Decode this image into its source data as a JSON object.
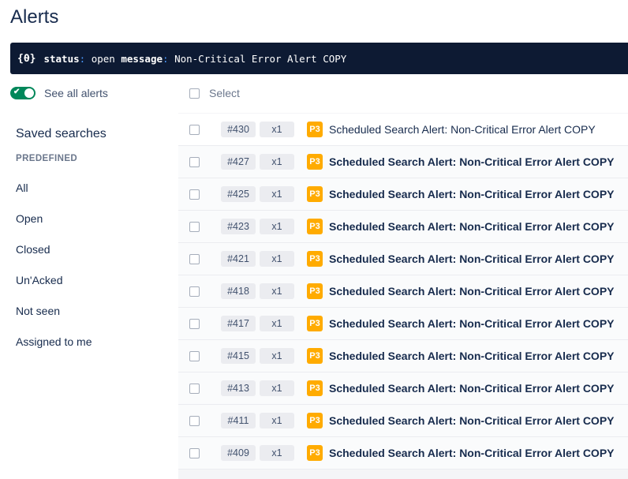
{
  "page": {
    "title": "Alerts"
  },
  "search": {
    "icon": "query-icon",
    "icon_glyph": "{⍬}",
    "query_tokens": [
      {
        "kind": "key",
        "text": "status"
      },
      {
        "kind": "colon",
        "text": ":"
      },
      {
        "kind": "val",
        "text": " open "
      },
      {
        "kind": "key",
        "text": "message"
      },
      {
        "kind": "colon",
        "text": ":"
      },
      {
        "kind": "val",
        "text": " Non-Critical Error Alert COPY"
      }
    ]
  },
  "toggle": {
    "label": "See all alerts",
    "checked": true,
    "color": "#00875a"
  },
  "select": {
    "label": "Select"
  },
  "sidebar": {
    "heading": "Saved searches",
    "section": "PREDEFINED",
    "items": [
      {
        "label": "All"
      },
      {
        "label": "Open"
      },
      {
        "label": "Closed"
      },
      {
        "label": "Un'Acked"
      },
      {
        "label": "Not seen"
      },
      {
        "label": "Assigned to me"
      }
    ]
  },
  "alerts": [
    {
      "id": "#430",
      "count": "x1",
      "priority": "P3",
      "title": "Scheduled Search Alert: Non-Critical Error Alert COPY",
      "unread": false
    },
    {
      "id": "#427",
      "count": "x1",
      "priority": "P3",
      "title": "Scheduled Search Alert: Non-Critical Error Alert COPY",
      "unread": true
    },
    {
      "id": "#425",
      "count": "x1",
      "priority": "P3",
      "title": "Scheduled Search Alert: Non-Critical Error Alert COPY",
      "unread": true
    },
    {
      "id": "#423",
      "count": "x1",
      "priority": "P3",
      "title": "Scheduled Search Alert: Non-Critical Error Alert COPY",
      "unread": true
    },
    {
      "id": "#421",
      "count": "x1",
      "priority": "P3",
      "title": "Scheduled Search Alert: Non-Critical Error Alert COPY",
      "unread": true
    },
    {
      "id": "#418",
      "count": "x1",
      "priority": "P3",
      "title": "Scheduled Search Alert: Non-Critical Error Alert COPY",
      "unread": true
    },
    {
      "id": "#417",
      "count": "x1",
      "priority": "P3",
      "title": "Scheduled Search Alert: Non-Critical Error Alert COPY",
      "unread": true
    },
    {
      "id": "#415",
      "count": "x1",
      "priority": "P3",
      "title": "Scheduled Search Alert: Non-Critical Error Alert COPY",
      "unread": true
    },
    {
      "id": "#413",
      "count": "x1",
      "priority": "P3",
      "title": "Scheduled Search Alert: Non-Critical Error Alert COPY",
      "unread": true
    },
    {
      "id": "#411",
      "count": "x1",
      "priority": "P3",
      "title": "Scheduled Search Alert: Non-Critical Error Alert COPY",
      "unread": true
    },
    {
      "id": "#409",
      "count": "x1",
      "priority": "P3",
      "title": "Scheduled Search Alert: Non-Critical Error Alert COPY",
      "unread": true
    }
  ],
  "colors": {
    "priority_p3": "#ffab00",
    "search_bg": "#0d1a33"
  }
}
